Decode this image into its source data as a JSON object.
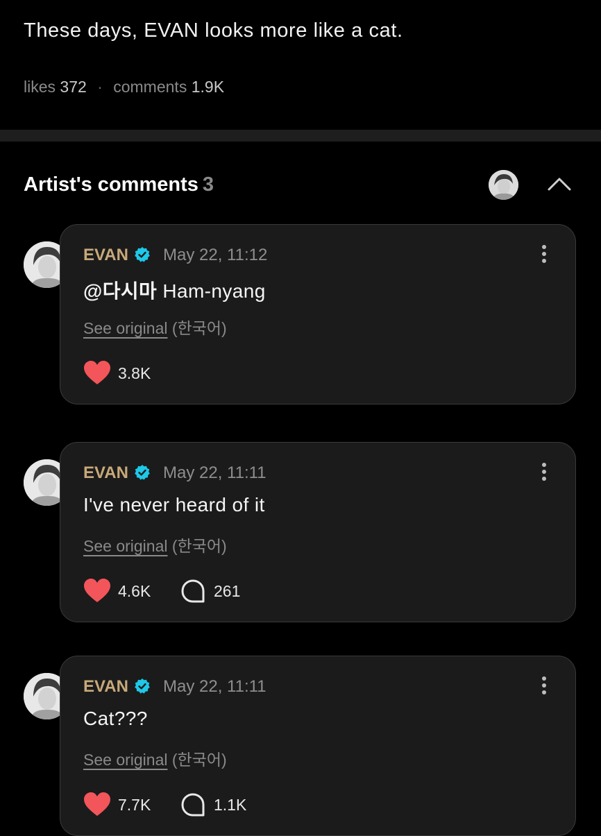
{
  "post": {
    "text": "These days, EVAN looks more like a cat.",
    "likes_label": "likes",
    "likes_count": "372",
    "separator": "·",
    "comments_label": "comments",
    "comments_count": "1.9K"
  },
  "artist_section": {
    "title": "Artist's comments",
    "count": "3"
  },
  "colors": {
    "accent_author": "#c8a97a",
    "verified": "#1ec8e8",
    "heart": "#f2555a",
    "card_bg": "#1b1b1b"
  },
  "comments": [
    {
      "author": "EVAN",
      "time": "May 22, 11:12",
      "mention": "@다시마",
      "text": " Ham-nyang",
      "see_original": "See original",
      "language": "(한국어)",
      "likes": "3.8K",
      "replies": null
    },
    {
      "author": "EVAN",
      "time": "May 22, 11:11",
      "mention": "",
      "text": "I've never heard of it",
      "see_original": "See original",
      "language": "(한국어)",
      "likes": "4.6K",
      "replies": "261"
    },
    {
      "author": "EVAN",
      "time": "May 22, 11:11",
      "mention": "",
      "text": "Cat???",
      "see_original": "See original",
      "language": "(한국어)",
      "likes": "7.7K",
      "replies": "1.1K"
    }
  ]
}
